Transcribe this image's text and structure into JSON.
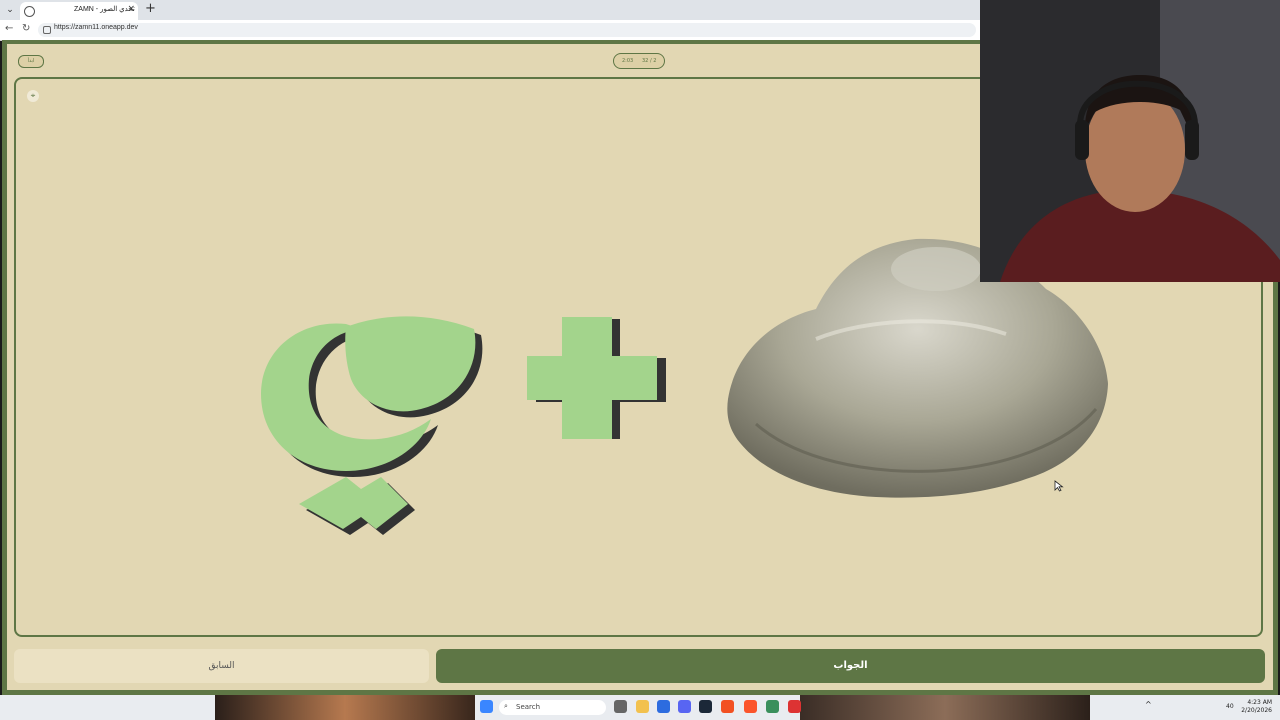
{
  "browser": {
    "tab_title": "ZAMN - تحدي الصور",
    "new_tab": "+",
    "url": "https://zamn11.oneapp.dev"
  },
  "app": {
    "top_left_button": "ابدأ",
    "counter_time": "2:03",
    "counter_progress": "32 / 2",
    "prev_button": "السابق",
    "answer_button": "الجواب",
    "colors": {
      "primary": "#5e7645",
      "background": "#e2d7b3",
      "glyph": "#a3d48c",
      "shadow": "#333333"
    }
  },
  "puzzle": {
    "items": [
      "arabic-letter-glyph",
      "plus-sign",
      "rock-image"
    ]
  },
  "taskbar": {
    "search_placeholder": "Search",
    "time": "4:23 AM",
    "date": "2/20/2026",
    "battery_label": "40"
  }
}
